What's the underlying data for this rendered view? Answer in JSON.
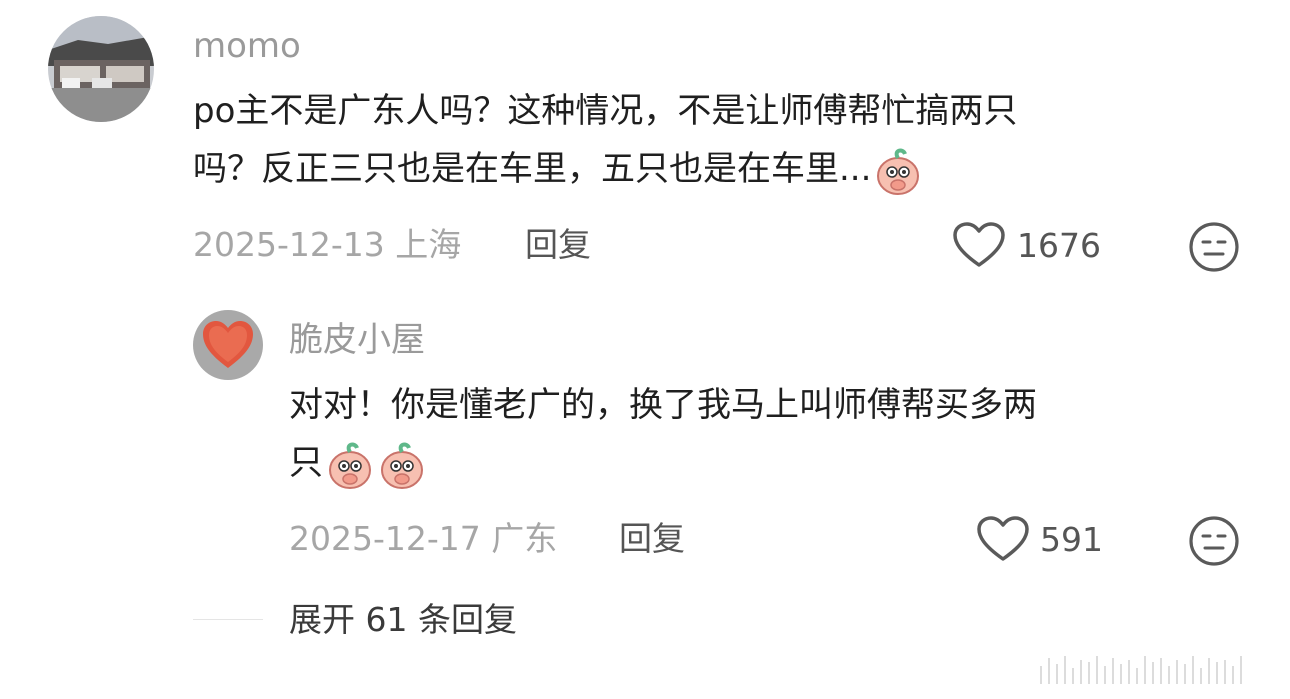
{
  "comment": {
    "username": "momo",
    "text_line1": "po主不是广东人吗？这种情况，不是让师傅帮忙搞两只",
    "text_line2": "吗？反正三只也是在车里，五只也是在车里...",
    "emoji": "peach-cover-mouth-icon",
    "date_location": "2025-12-13 上海",
    "reply_label": "回复",
    "like_count": "1676"
  },
  "reply": {
    "username": "脆皮小屋",
    "text_line1": "对对！你是懂老广的，换了我马上叫师傅帮买多两",
    "text_line2": "只",
    "emoji": "peach-cover-mouth-icon",
    "date_location": "2025-12-17 广东",
    "reply_label": "回复",
    "like_count": "591"
  },
  "expand_label": "展开 61 条回复",
  "colors": {
    "text": "#1f1f1f",
    "muted": "#a6a6a6",
    "peach": "#f5b6a8",
    "leaf": "#5fb88a"
  }
}
